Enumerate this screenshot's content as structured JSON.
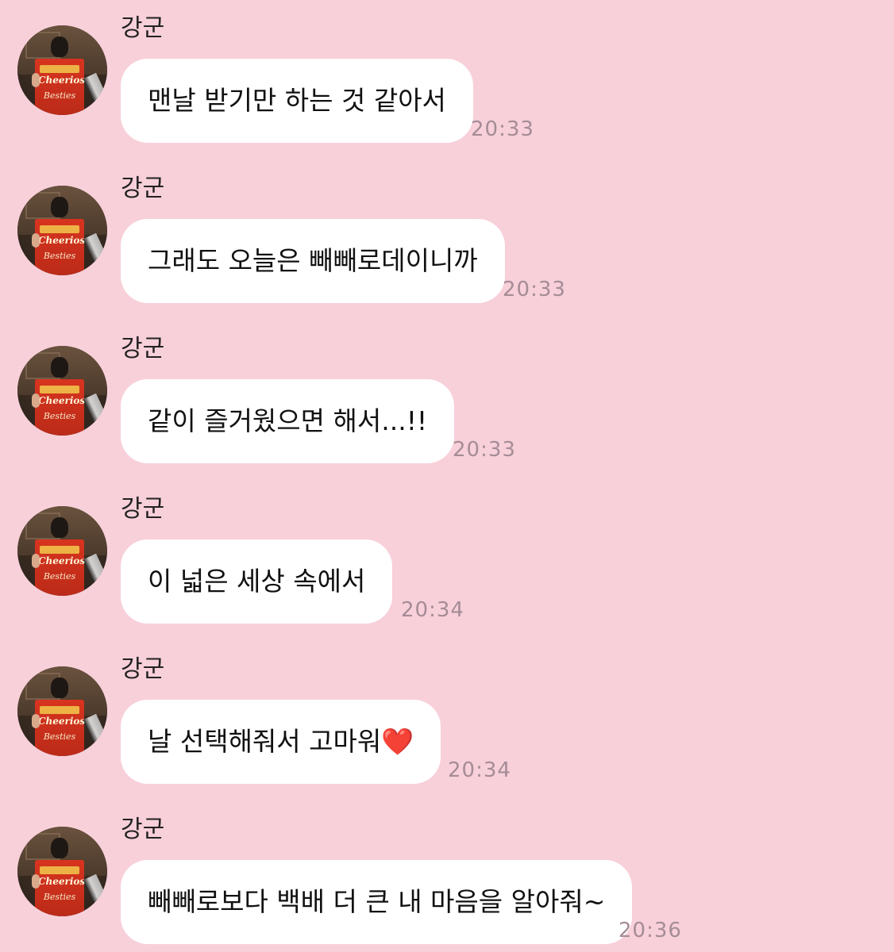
{
  "messages": [
    {
      "sender": "강군",
      "text": "맨날 받기만 하는 것 같아서",
      "time": "20:33"
    },
    {
      "sender": "강군",
      "text": "그래도 오늘은 빼빼로데이니까",
      "time": "20:33"
    },
    {
      "sender": "강군",
      "text": "같이 즐거웠으면 해서...!!",
      "time": "20:33"
    },
    {
      "sender": "강군",
      "text": "이 넓은 세상 속에서",
      "time": "20:34"
    },
    {
      "sender": "강군",
      "text": "날 선택해줘서 고마워❤️",
      "time": "20:34"
    },
    {
      "sender": "강군",
      "text": "빼빼로보다 백배 더 큰 내 마음을 알아줘~",
      "time": "20:36"
    }
  ],
  "avatar": {
    "icon": "profile-photo-cheerios-box",
    "box_text_1": "Cheerios",
    "box_text_2": "Besties"
  },
  "colors": {
    "background": "#f8d0da",
    "bubble": "#ffffff",
    "timestamp": "#a58c96"
  }
}
